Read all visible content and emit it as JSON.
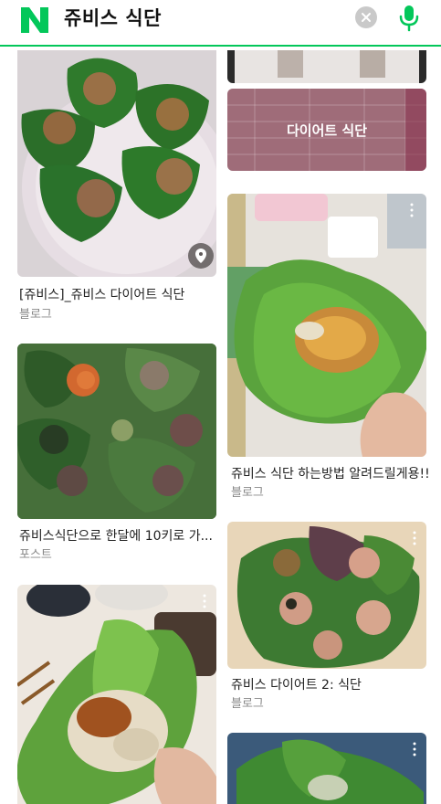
{
  "search": {
    "query": "쥬비스 식단"
  },
  "colors": {
    "brand": "#03c75a",
    "title": "#222222",
    "source": "#888888"
  },
  "icons": {
    "logo": "naver-n-icon",
    "clear": "clear-icon",
    "mic": "microphone-icon",
    "location": "location-pin-icon"
  },
  "results": [
    {
      "title": "[쥬비스]_쥬비스 다이어트 식단",
      "source": "블로그"
    },
    {
      "title": "쥬비스 식단 하는방법 알려드릴게용!!",
      "source": "블로그"
    },
    {
      "title": "쥬비스식단으로 한달에 10키로 가...",
      "source": "포스트"
    },
    {
      "title": "쥬비스 다이어트 2: 식단",
      "source": "블로그"
    }
  ],
  "overlay": {
    "label": "다이어트 식단"
  }
}
